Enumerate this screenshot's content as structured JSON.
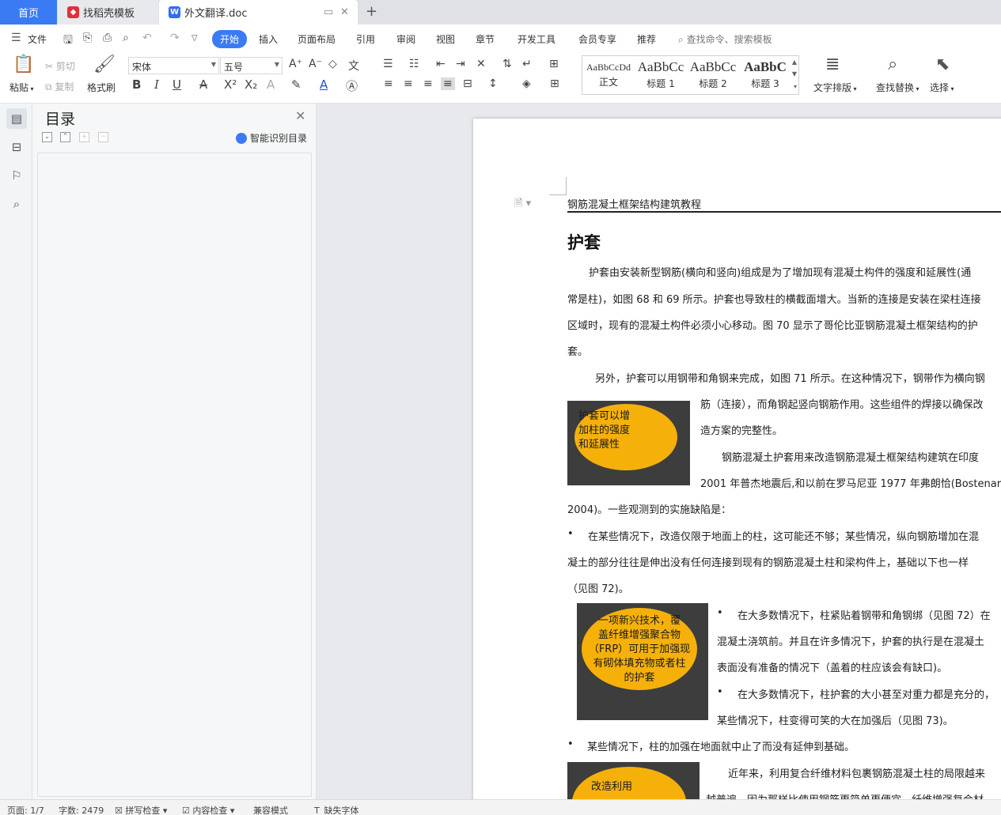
{
  "tabs": {
    "home": "首页",
    "template": "找稻壳模板",
    "document": "外文翻译.doc"
  },
  "menu": {
    "file": "文件",
    "items": [
      "开始",
      "插入",
      "页面布局",
      "引用",
      "审阅",
      "视图",
      "章节",
      "开发工具",
      "会员专享",
      "推荐"
    ],
    "search": "查找命令、搜索模板"
  },
  "ribbon": {
    "paste": "粘贴",
    "cut": "剪切",
    "copy": "复制",
    "format_painter": "格式刷",
    "font_name": "宋体",
    "font_size": "五号",
    "styles": [
      {
        "sample": "AaBbCcDd",
        "name": "正文"
      },
      {
        "sample": "AaBbCc",
        "name": "标题 1"
      },
      {
        "sample": "AaBbCc",
        "name": "标题 2"
      },
      {
        "sample": "AaBbC",
        "name": "标题 3"
      }
    ],
    "text_layout": "文字排版",
    "find_replace": "查找替换",
    "select": "选择"
  },
  "toc": {
    "title": "目录",
    "smart": "智能识别目录"
  },
  "document": {
    "header": "钢筋混凝土框架结构建筑教程",
    "title": "护套",
    "lines": [
      "护套由安装新型钢筋(横向和竖向)组成是为了增加现有混凝土构件的强度和延展性(通",
      "常是柱)，如图 68 和 69 所示。护套也导致柱的横截面增大。当新的连接是安装在梁柱连接",
      "区域时，现有的混凝土构件必须小心移动。图 70 显示了哥伦比亚钢筋混凝土框架结构的护",
      "套。",
      "另外，护套可以用钢带和角钢来完成，如图 71 所示。在这种情况下，钢带作为横向钢",
      "筋（连接），而角钢起竖向钢筋作用。这些组件的焊接以确保改",
      "造方案的完整性。",
      "钢筋混凝土护套用来改造钢筋混凝土框架结构建筑在印度",
      "2001 年普杰地震后,和以前在罗马尼亚 1977 年弗朗恰(Bostenar",
      "2004)。一些观测到的实施缺陷是：",
      "在某些情况下，改造仅限于地面上的柱，这可能还不够；某些情况，纵向钢筋增加在混",
      "凝土的部分往往是伸出没有任何连接到现有的钢筋混凝土柱和梁构件上，基础以下也一样",
      "（见图 72)。",
      "在大多数情况下，柱紧贴着钢带和角钢绑（见图 72）在",
      "混凝土浇筑前。并且在许多情况下，护套的执行是在混凝土",
      "表面没有准备的情况下（盖着的柱应该会有缺口)。",
      "在大多数情况下，柱护套的大小甚至对重力都是充分的，",
      "某些情况下，柱变得可笑的大在加强后（见图 73)。",
      "某些情况下，柱的加强在地面就中止了而没有延伸到基础。",
      "近年来，利用复合纤维材料包裹钢筋混凝土柱的局限越来",
      "越普遍，因为那样比使用钢筋更简单更便宜。纤维增强复合材"
    ],
    "bullet": "•",
    "fig1": [
      "护套可以增",
      "加柱的强度",
      "和延展性"
    ],
    "fig2": [
      "一项新兴技术，覆",
      "盖纤维增强聚合物",
      "（FRP）可用于加强现",
      "有砌体填充物或者柱",
      "的护套"
    ],
    "fig3": [
      "改造利用"
    ]
  },
  "status": {
    "page": "页面: 1/7",
    "words": "字数: 2479",
    "spell": "拼写检查",
    "content": "内容检查",
    "compat": "兼容模式",
    "missing_font": "缺失字体"
  },
  "colors": {
    "accent": "#3a7bf4",
    "figure_bg": "#3d3d3d",
    "figure_ellipse": "#f5b10a"
  }
}
